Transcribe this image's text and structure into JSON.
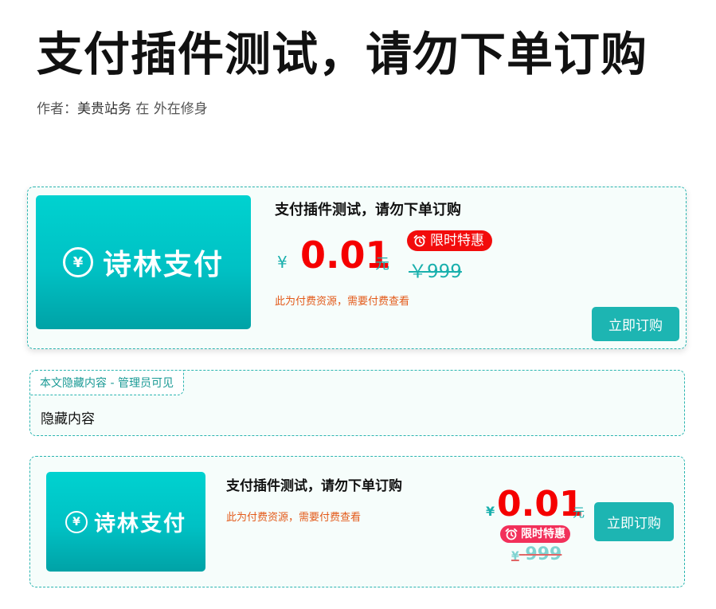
{
  "post": {
    "title": "支付插件测试，请勿下单订购",
    "author_label": "作者：",
    "author": "美贵站务",
    "category_prefix": "在",
    "category": "外在修身"
  },
  "card1": {
    "logo_symbol": "¥",
    "logo_text": "诗林支付",
    "product_title": "支付插件测试，请勿下单订购",
    "currency": "¥",
    "price": "0.01",
    "unit": "元",
    "badge": "限时特惠",
    "original_price": "￥999",
    "note": "此为付费资源，需要付费查看",
    "buy_label": "立即订购"
  },
  "hidden": {
    "tag": "本文隐藏内容 - 管理员可见",
    "content": "隐藏内容"
  },
  "card2": {
    "logo_symbol": "¥",
    "logo_text": "诗林支付",
    "product_title": "支付插件测试，请勿下单订购",
    "note": "此为付费资源，需要付费查看",
    "currency": "¥",
    "price": "0.01",
    "unit": "元",
    "badge": "限时特惠",
    "original_currency": "¥",
    "original_price": "999",
    "buy_label": "立即订购"
  },
  "colors": {
    "accent": "#1db5b2",
    "price": "#f50000",
    "badge": "#f20c0c",
    "note": "#e35a1a"
  },
  "icons": [
    "alarm-clock-icon",
    "yen-coin-icon"
  ]
}
